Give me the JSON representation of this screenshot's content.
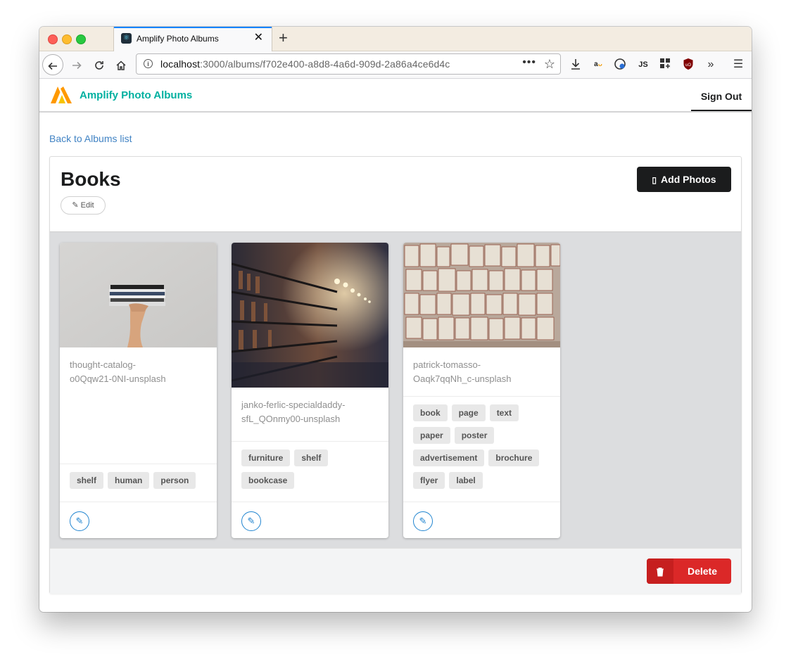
{
  "browser": {
    "tab_title": "Amplify Photo Albums",
    "tab_close": "✕",
    "new_tab": "+",
    "url_host": "localhost",
    "url_path": ":3000/albums/f702e400-a8d8-4a6d-909d-2a86a4ce6d4c",
    "url_more": "•••",
    "toolbar_icons": [
      "download-icon",
      "amazon-icon",
      "extension-icon",
      "js-icon",
      "apps-icon",
      "ublock-icon",
      "overflow-icon",
      "menu-icon"
    ],
    "js_label": "JS"
  },
  "header": {
    "brand": "Amplify Photo Albums",
    "sign_out": "Sign Out"
  },
  "back_link": "Back to Albums list",
  "album": {
    "title": "Books",
    "edit_label": "Edit",
    "add_photos_label": "Add Photos",
    "delete_label": "Delete"
  },
  "photos": [
    {
      "name": "thought-catalog-o0Qqw21-0NI-unsplash",
      "name_lines": [
        "thought-catalog-",
        "o0Qqw21-0NI-unsplash"
      ],
      "tags": [
        "shelf",
        "human",
        "person"
      ]
    },
    {
      "name": "janko-ferlic-specialdaddy-sfL_QOnmy00-unsplash",
      "name_lines": [
        "janko-ferlic-specialdaddy-",
        "sfL_QOnmy00-unsplash"
      ],
      "tags": [
        "furniture",
        "shelf",
        "bookcase"
      ]
    },
    {
      "name": "patrick-tomasso-Oaqk7qqNh_c-unsplash",
      "name_lines": [
        "patrick-tomasso-",
        "Oaqk7qqNh_c-unsplash"
      ],
      "tags": [
        "book",
        "page",
        "text",
        "paper",
        "poster",
        "advertisement",
        "brochure",
        "flyer",
        "label"
      ]
    }
  ],
  "colors": {
    "brand": "#00b0a0",
    "link": "#4183c4",
    "primary_dark": "#1b1c1d",
    "danger": "#db2828",
    "edit_blue": "#2185d0"
  }
}
